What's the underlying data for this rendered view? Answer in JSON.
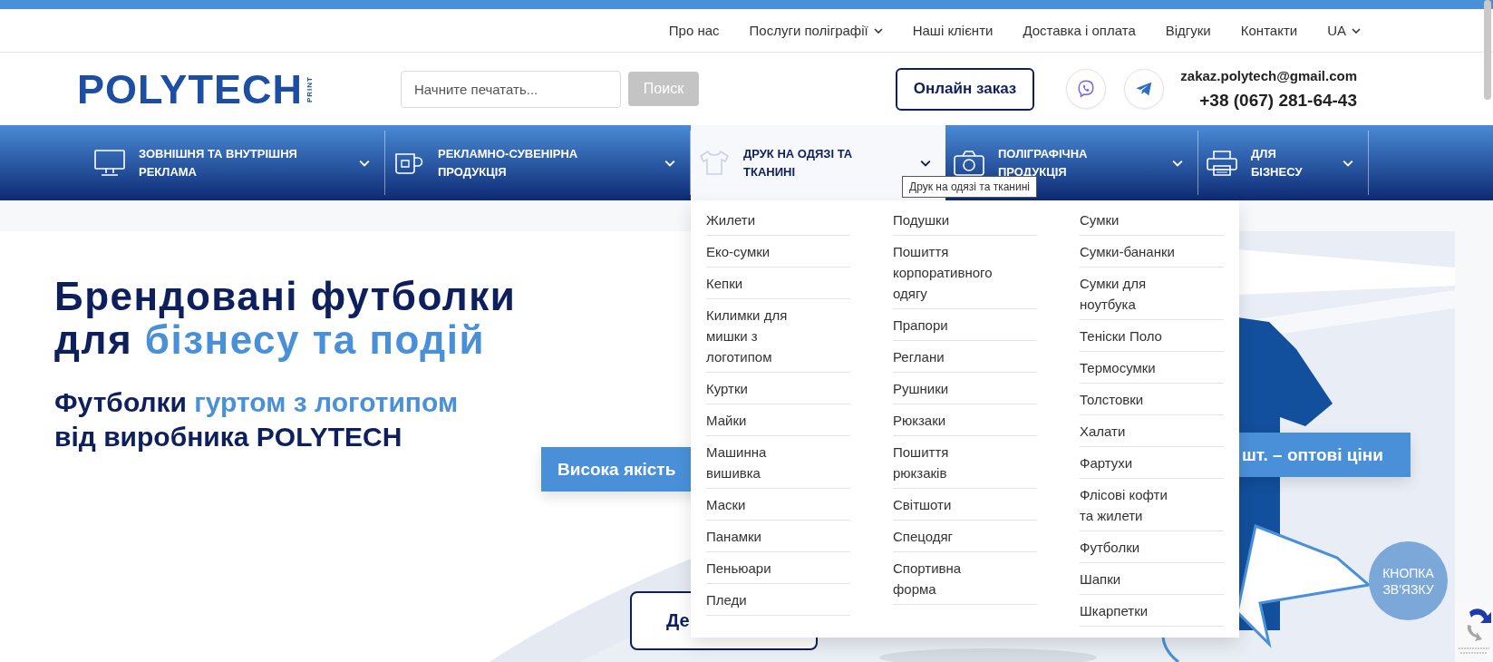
{
  "top_nav": [
    {
      "label": "Про нас",
      "has_dropdown": false
    },
    {
      "label": "Послуги поліграфії",
      "has_dropdown": true
    },
    {
      "label": "Наші клієнти",
      "has_dropdown": false
    },
    {
      "label": "Доставка і оплата",
      "has_dropdown": false
    },
    {
      "label": "Відгуки",
      "has_dropdown": false
    },
    {
      "label": "Контакти",
      "has_dropdown": false
    },
    {
      "label": "UA",
      "has_dropdown": true
    }
  ],
  "header": {
    "logo": {
      "text": "POLYTECH",
      "subtext": "PRINT"
    },
    "search": {
      "placeholder": "Начните печатать...",
      "button": "Поиск"
    },
    "order_button": "Онлайн заказ",
    "email": "zakaz.polytech@gmail.com",
    "phone": "+38 (067) 281-64-43"
  },
  "main_nav": [
    {
      "label_lines": [
        "ЗОВНІШНЯ ТА ВНУТРІШНЯ",
        "РЕКЛАМА"
      ],
      "selected": false
    },
    {
      "label_lines": [
        "РЕКЛАМНО-СУВЕНІРНА",
        "ПРОДУКЦІЯ"
      ],
      "selected": false
    },
    {
      "label_lines": [
        "ДРУК НА ОДЯЗІ ТА",
        "ТКАНИНІ"
      ],
      "selected": true
    },
    {
      "label_lines": [
        "ПОЛІГРАФІЧНА",
        "ПРОДУКЦІЯ"
      ],
      "selected": false
    },
    {
      "label_lines": [
        "ДЛЯ",
        "БІЗНЕСУ"
      ],
      "selected": false
    }
  ],
  "dropdown": {
    "columns": [
      [
        "Жилети",
        "Еко-сумки",
        "Кепки",
        "Килимки для мишки з логотипом",
        "Куртки",
        "Майки",
        "Машинна вишивка",
        "Маски",
        "Панамки",
        "Пеньюари",
        "Пледи"
      ],
      [
        "Подушки",
        "Пошиття корпоративного одягу",
        "Прапори",
        "Реглани",
        "Рушники",
        "Рюкзаки",
        "Пошиття рюкзаків",
        "Світшоти",
        "Спецодяг",
        "Спортивна форма"
      ],
      [
        "Сумки",
        "Сумки-бананки",
        "Сумки для ноутбука",
        "Теніски Поло",
        "Термосумки",
        "Толстовки",
        "Халати",
        "Фартухи",
        "Флісові кофти та жилети",
        "Футболки",
        "Шапки",
        "Шкарпетки"
      ]
    ]
  },
  "tooltip": "Друк на одязі та тканині",
  "hero": {
    "title": [
      [
        {
          "text": "Брендовані футболки",
          "accent": false
        }
      ],
      [
        {
          "text": "для",
          "accent": false
        },
        {
          "text": "бізнесу та подій",
          "accent": true
        }
      ]
    ],
    "subtitle": [
      [
        {
          "text": "Футболки",
          "accent": false
        },
        {
          "text": "гуртом з логотипом",
          "accent": true
        }
      ],
      [
        {
          "text": "від виробника POLYTECH",
          "accent": false
        }
      ]
    ],
    "banners": [
      "Висока якість",
      "шт. – оптові ціни"
    ],
    "cta": "Де"
  },
  "contact_button": "КНОПКА ЗВ'ЯЗКУ"
}
